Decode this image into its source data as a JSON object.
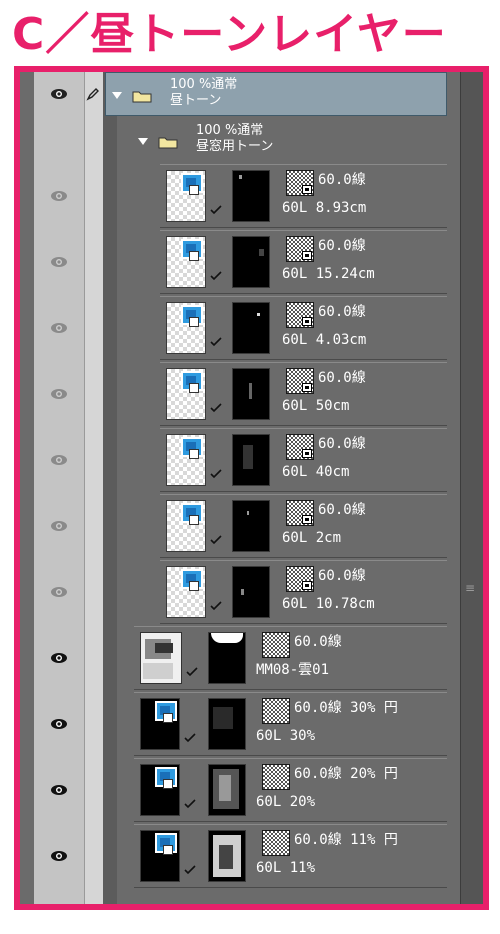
{
  "header": {
    "title": "C／昼トーンレイヤー"
  },
  "colors": {
    "accent": "#e8206a",
    "panel": "#6b6b6b",
    "selected_group": "#8ea1ad"
  },
  "groups": [
    {
      "line1": "100 %通常",
      "line2": "昼トーン"
    },
    {
      "line1": "100 %通常",
      "line2": "昼窓用トーン"
    }
  ],
  "layers": [
    {
      "tone": "60.0線",
      "info": "60L 8.93cm"
    },
    {
      "tone": "60.0線",
      "info": "60L 15.24cm"
    },
    {
      "tone": "60.0線",
      "info": "60L 4.03cm"
    },
    {
      "tone": "60.0線",
      "info": "60L 50cm"
    },
    {
      "tone": "60.0線",
      "info": "60L 40cm"
    },
    {
      "tone": "60.0線",
      "info": "60L 2cm"
    },
    {
      "tone": "60.0線",
      "info": "60L 10.78cm"
    },
    {
      "tone": "60.0線",
      "info": "MM08-雲01"
    },
    {
      "tone": "60.0線 30% 円",
      "info": "60L 30%"
    },
    {
      "tone": "60.0線 20% 円",
      "info": "60L 20%"
    },
    {
      "tone": "60.0線 11% 円",
      "info": "60L 11%"
    }
  ],
  "icons": [
    "eye-icon",
    "pen-icon",
    "folder-icon",
    "expand-triangle-icon",
    "check-icon",
    "tone-icon"
  ]
}
